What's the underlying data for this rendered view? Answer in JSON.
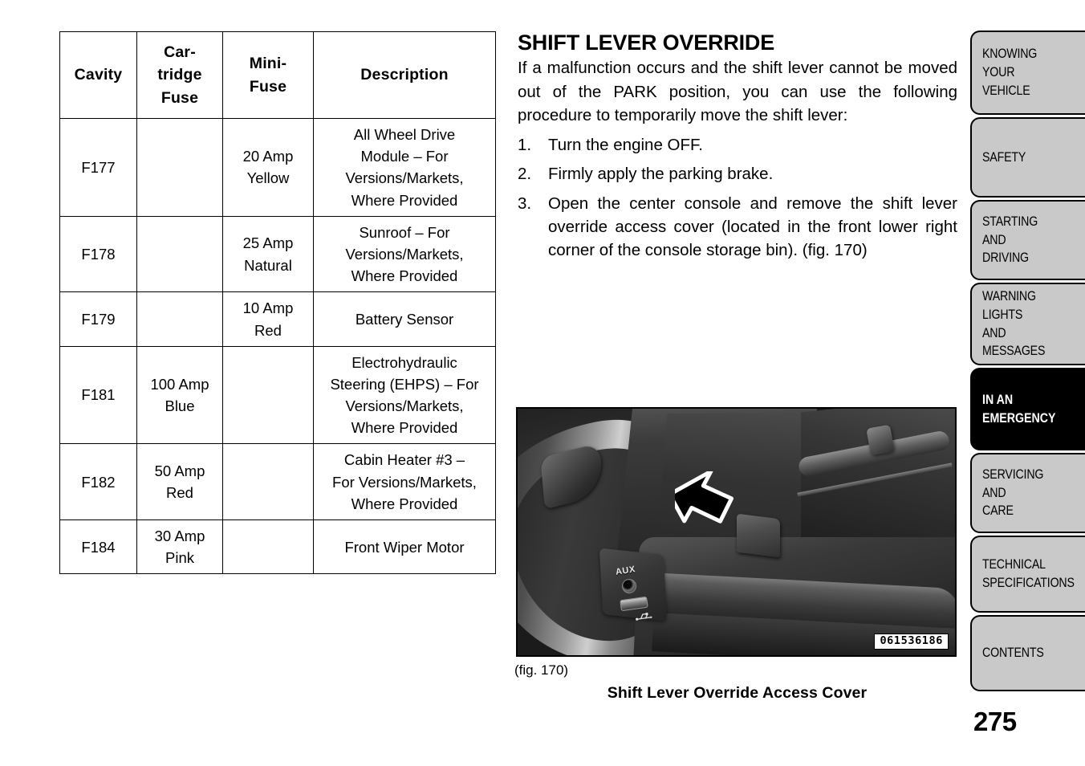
{
  "fuse_table": {
    "headers": [
      "Cavity",
      "Car-\ntridge\nFuse",
      "Mini-\nFuse",
      "Description"
    ],
    "rows": [
      {
        "cavity": "F177",
        "cartridge_fuse": "",
        "mini_fuse": "20 Amp\nYellow",
        "description": "All Wheel Drive\nModule – For\nVersions/Markets,\nWhere Provided"
      },
      {
        "cavity": "F178",
        "cartridge_fuse": "",
        "mini_fuse": "25 Amp\nNatural",
        "description": "Sunroof – For\nVersions/Markets,\nWhere Provided"
      },
      {
        "cavity": "F179",
        "cartridge_fuse": "",
        "mini_fuse": "10 Amp\nRed",
        "description": "Battery Sensor"
      },
      {
        "cavity": "F181",
        "cartridge_fuse": "100 Amp\nBlue",
        "mini_fuse": "",
        "description": "Electrohydraulic\nSteering (EHPS) – For\nVersions/Markets,\nWhere Provided"
      },
      {
        "cavity": "F182",
        "cartridge_fuse": "50 Amp\nRed",
        "mini_fuse": "",
        "description": "Cabin Heater #3 –\nFor Versions/Markets,\nWhere Provided"
      },
      {
        "cavity": "F184",
        "cartridge_fuse": "30 Amp\nPink",
        "mini_fuse": "",
        "description": "Front Wiper Motor"
      }
    ]
  },
  "article": {
    "heading": "SHIFT LEVER OVERRIDE",
    "intro": "If a malfunction occurs and the shift lever cannot be moved out of the PARK position, you can use the following procedure to temporarily move the shift lever:",
    "steps": [
      {
        "number": "1.",
        "text": "Turn the engine OFF."
      },
      {
        "number": "2.",
        "text": "Firmly apply the parking brake."
      },
      {
        "number": "3.",
        "text": "Open the center console and remove the shift lever override access cover (located in the front lower right corner of the console storage bin).  (fig.  170)"
      }
    ]
  },
  "figure": {
    "reference": "(fig. 170)",
    "title": "Shift Lever Override Access Cover",
    "photo_id": "061536186",
    "aux_label": "AUX"
  },
  "tabs": [
    {
      "label": "KNOWING\nYOUR\nVEHICLE",
      "active": false
    },
    {
      "label": "SAFETY",
      "active": false
    },
    {
      "label": "STARTING\nAND\nDRIVING",
      "active": false
    },
    {
      "label": "WARNING\nLIGHTS\nAND\nMESSAGES",
      "active": false
    },
    {
      "label": "IN AN\nEMERGENCY",
      "active": true
    },
    {
      "label": "SERVICING\nAND\nCARE",
      "active": false
    },
    {
      "label": "TECHNICAL\nSPECIFICATIONS",
      "active": false
    },
    {
      "label": "CONTENTS",
      "active": false
    }
  ],
  "page_number": "275",
  "colors": {
    "tab_inactive_bg": "#c9c9c9",
    "tab_active_bg": "#000000",
    "tab_active_text": "#ffffff",
    "text": "#000000",
    "page_bg": "#ffffff"
  }
}
